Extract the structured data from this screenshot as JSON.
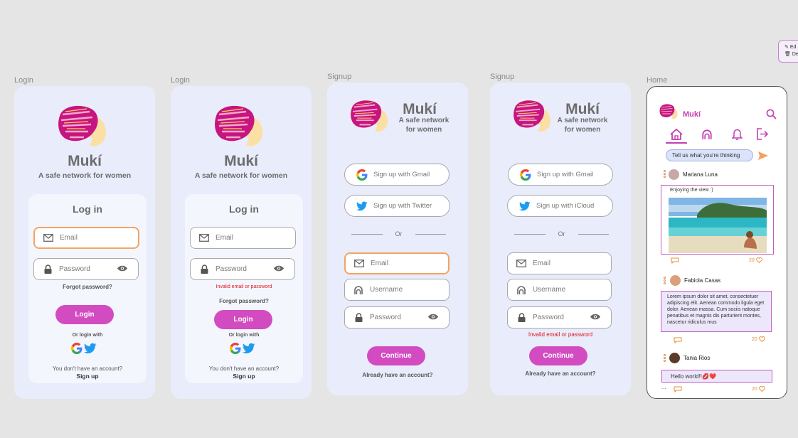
{
  "brand": {
    "name": "Mukí",
    "tagline": "A safe network for women",
    "tagline_l1": "A safe network",
    "tagline_l2": "for women"
  },
  "frames": {
    "login1": "Login",
    "login2": "Login",
    "signup1": "Signup",
    "signup2": "Signup",
    "home": "Home"
  },
  "login": {
    "title": "Log in",
    "email_placeholder": "Email",
    "password_placeholder": "Password",
    "forgot": "Forgot password?",
    "error": "Invalid email or password",
    "login_button": "Login",
    "or_login_with": "Or login with",
    "no_account": "You don't have an account?",
    "signup_link": "Sign up"
  },
  "signup": {
    "google": "Sign up with Gmail",
    "twitter": "Sign up with  Twitter",
    "icloud": "Sign up with  iCloud",
    "or": "Or",
    "email_placeholder": "Email",
    "username_placeholder": "Username",
    "password_placeholder": "Password",
    "error": "Invalid email or password",
    "continue_button": "Continue",
    "have_account": "Already have an account?"
  },
  "home": {
    "brand": "Mukí",
    "compose_placeholder": "Tell us what you're thinking",
    "posts": [
      {
        "user": "Mariana Luna",
        "text": "Enjoying the view :)",
        "likes": "20"
      },
      {
        "user": "Fabiola Casas",
        "text": "Lorem ipsum dolor sit amet, consectetuer adipiscing elit. Aenean commodo ligula eget dolor. Aenean massa. Cum sociis natoque penatibus et magnis dis parturient montes, nascetur ridiculus mus",
        "likes": "20"
      },
      {
        "user": "Tania Rios",
        "text": "Hello world!!💋❤️",
        "likes": "20"
      }
    ],
    "more": "..."
  },
  "tooltip": {
    "edit": "Ed",
    "delete": "De"
  },
  "colors": {
    "accent": "#d34bc0",
    "frame_bg": "#e9ecfb",
    "focus": "#f4a464",
    "error": "#e0141e",
    "home_accent": "#c33fb3"
  }
}
